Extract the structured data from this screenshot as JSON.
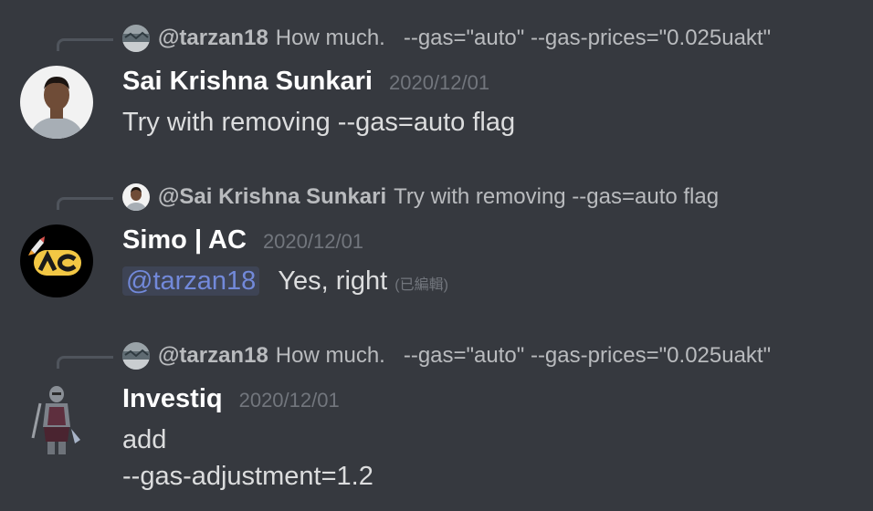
{
  "messages": [
    {
      "reply": {
        "user": "@tarzan18",
        "text": "How much.   --gas=\"auto\" --gas-prices=\"0.025uakt\"",
        "avatar": "blurry-landscape-avatar"
      },
      "author": "Sai Krishna Sunkari",
      "timestamp": "2020/12/01",
      "content": "Try with removing --gas=auto flag"
    },
    {
      "reply": {
        "user": "@Sai Krishna Sunkari",
        "text": "Try with removing --gas=auto flag",
        "avatar": "person-avatar"
      },
      "author": "Simo | AC",
      "timestamp": "2020/12/01",
      "mention": "@tarzan18",
      "content": "Yes, right",
      "edited": "(已編輯)"
    },
    {
      "reply": {
        "user": "@tarzan18",
        "text": "How much.   --gas=\"auto\" --gas-prices=\"0.025uakt\"",
        "avatar": "blurry-landscape-avatar"
      },
      "author": "Investiq",
      "timestamp": "2020/12/01",
      "content_lines": [
        "add",
        "--gas-adjustment=1.2"
      ]
    }
  ],
  "colors": {
    "background": "#36393f",
    "username": "#ffffff",
    "text": "#dcddde",
    "muted": "#72767d",
    "reply_text": "#b9bbbe",
    "mention": "#7289da",
    "spine": "#4f545c"
  }
}
